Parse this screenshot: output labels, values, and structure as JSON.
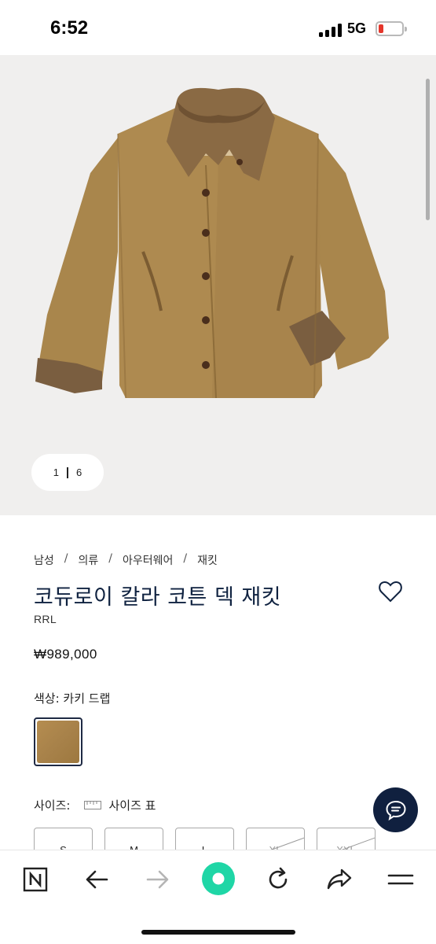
{
  "status_bar": {
    "time": "6:52",
    "network": "5G",
    "battery_color": "#e5362b"
  },
  "gallery": {
    "current": "1",
    "total": "6"
  },
  "breadcrumb": [
    "남성",
    "의류",
    "아우터웨어",
    "재킷"
  ],
  "breadcrumb_separator": "/",
  "product": {
    "title": "코듀로이 칼라 코튼 덱 재킷",
    "brand": "RRL",
    "price": "₩989,000",
    "color_label": "색상: 카키 드랩",
    "swatch_color": "#a8824a"
  },
  "size_section": {
    "label": "사이즈:",
    "chart_label": "사이즈 표",
    "options": [
      {
        "label": "S",
        "available": true
      },
      {
        "label": "M",
        "available": true
      },
      {
        "label": "L",
        "available": true
      },
      {
        "label": "XL",
        "available": false
      },
      {
        "label": "XXL",
        "available": false
      }
    ]
  },
  "toolbar": {
    "items": [
      "naver-icon",
      "back-icon",
      "forward-icon",
      "home-icon",
      "reload-icon",
      "share-icon",
      "menu-icon"
    ],
    "accent": "#1fd6a6"
  },
  "colors": {
    "title": "#0f2240",
    "chat_button": "#10203f"
  }
}
